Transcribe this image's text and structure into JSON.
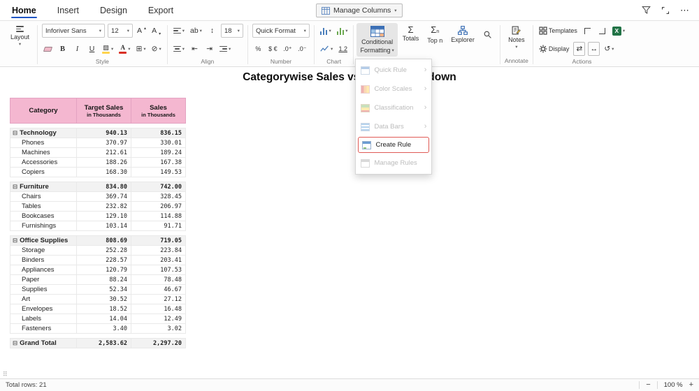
{
  "colors": {
    "accent_blue": "#1f55c4",
    "header_pink": "#f4b7d0",
    "create_rule_red": "#e05a55",
    "excel_green": "#217346"
  },
  "menubar": {
    "tabs": [
      {
        "label": "Home",
        "active": true
      },
      {
        "label": "Insert",
        "active": false
      },
      {
        "label": "Design",
        "active": false
      },
      {
        "label": "Export",
        "active": false
      }
    ],
    "manage_columns_label": "Manage Columns"
  },
  "ribbon": {
    "layout_label": "Layout",
    "style": {
      "group_label": "Style",
      "font_name": "Inforiver Sans",
      "font_size": "12",
      "bold": "B",
      "italic": "I",
      "underline": "U"
    },
    "align": {
      "group_label": "Align",
      "wrap_label": "ab",
      "row_height": "18"
    },
    "number": {
      "group_label": "Number",
      "quick_format_label": "Quick Format",
      "percent": "%",
      "currency": "$ €",
      "decimal_increase": ".0⁺",
      "decimal_decrease": ".0⁻"
    },
    "chart": {
      "group_label": "Chart",
      "decimal_label": "1.2"
    },
    "conditional_formatting": {
      "line1": "Conditional",
      "line2": "Formatting"
    },
    "totals_label": "Totals",
    "top_n_label": "Top n",
    "explorer_label": "Explorer",
    "notes_label": "Notes",
    "annotate_label": "Annotate",
    "templates_label": "Templates",
    "display_label": "Display",
    "actions_label": "Actions"
  },
  "cf_menu": {
    "items": [
      {
        "label": "Quick Rule",
        "icon": "quick-rule",
        "disabled": true,
        "submenu": true,
        "highlighted": false
      },
      {
        "label": "Color Scales",
        "icon": "color-scales",
        "disabled": true,
        "submenu": true,
        "highlighted": false
      },
      {
        "label": "Classification",
        "icon": "classification",
        "disabled": true,
        "submenu": true,
        "highlighted": false
      },
      {
        "label": "Data Bars",
        "icon": "data-bars",
        "disabled": true,
        "submenu": true,
        "highlighted": false
      },
      {
        "label": "Create Rule",
        "icon": "create-rule",
        "disabled": false,
        "submenu": false,
        "highlighted": true
      },
      {
        "label": "Manage Rules",
        "icon": "manage-rules",
        "disabled": true,
        "submenu": false,
        "highlighted": false
      }
    ]
  },
  "report": {
    "title": "Categorywise Sales vs Target Breakdown"
  },
  "table": {
    "columns": [
      {
        "label": "Category",
        "sub": ""
      },
      {
        "label": "Target Sales",
        "sub": "in Thousands"
      },
      {
        "label": "Sales",
        "sub": "in Thousands"
      }
    ],
    "rows": [
      {
        "type": "group",
        "label": "Technology",
        "target": "940.13",
        "sales": "836.15"
      },
      {
        "type": "child",
        "label": "Phones",
        "target": "370.97",
        "sales": "330.01"
      },
      {
        "type": "child",
        "label": "Machines",
        "target": "212.61",
        "sales": "189.24"
      },
      {
        "type": "child",
        "label": "Accessories",
        "target": "188.26",
        "sales": "167.38"
      },
      {
        "type": "child",
        "label": "Copiers",
        "target": "168.30",
        "sales": "149.53"
      },
      {
        "type": "group",
        "label": "Furniture",
        "target": "834.80",
        "sales": "742.00"
      },
      {
        "type": "child",
        "label": "Chairs",
        "target": "369.74",
        "sales": "328.45"
      },
      {
        "type": "child",
        "label": "Tables",
        "target": "232.82",
        "sales": "206.97"
      },
      {
        "type": "child",
        "label": "Bookcases",
        "target": "129.10",
        "sales": "114.88"
      },
      {
        "type": "child",
        "label": "Furnishings",
        "target": "103.14",
        "sales": "91.71"
      },
      {
        "type": "group",
        "label": "Office Supplies",
        "target": "808.69",
        "sales": "719.05"
      },
      {
        "type": "child",
        "label": "Storage",
        "target": "252.28",
        "sales": "223.84"
      },
      {
        "type": "child",
        "label": "Binders",
        "target": "228.57",
        "sales": "203.41"
      },
      {
        "type": "child",
        "label": "Appliances",
        "target": "120.79",
        "sales": "107.53"
      },
      {
        "type": "child",
        "label": "Paper",
        "target": "88.24",
        "sales": "78.48"
      },
      {
        "type": "child",
        "label": "Supplies",
        "target": "52.34",
        "sales": "46.67"
      },
      {
        "type": "child",
        "label": "Art",
        "target": "30.52",
        "sales": "27.12"
      },
      {
        "type": "child",
        "label": "Envelopes",
        "target": "18.52",
        "sales": "16.48"
      },
      {
        "type": "child",
        "label": "Labels",
        "target": "14.04",
        "sales": "12.49"
      },
      {
        "type": "child",
        "label": "Fasteners",
        "target": "3.40",
        "sales": "3.02"
      },
      {
        "type": "grand",
        "label": "Grand Total",
        "target": "2,583.62",
        "sales": "2,297.20"
      }
    ]
  },
  "status_bar": {
    "total_rows": "Total rows: 21",
    "zoom_level": "100 %",
    "zoom_out": "−",
    "zoom_in": "+"
  }
}
